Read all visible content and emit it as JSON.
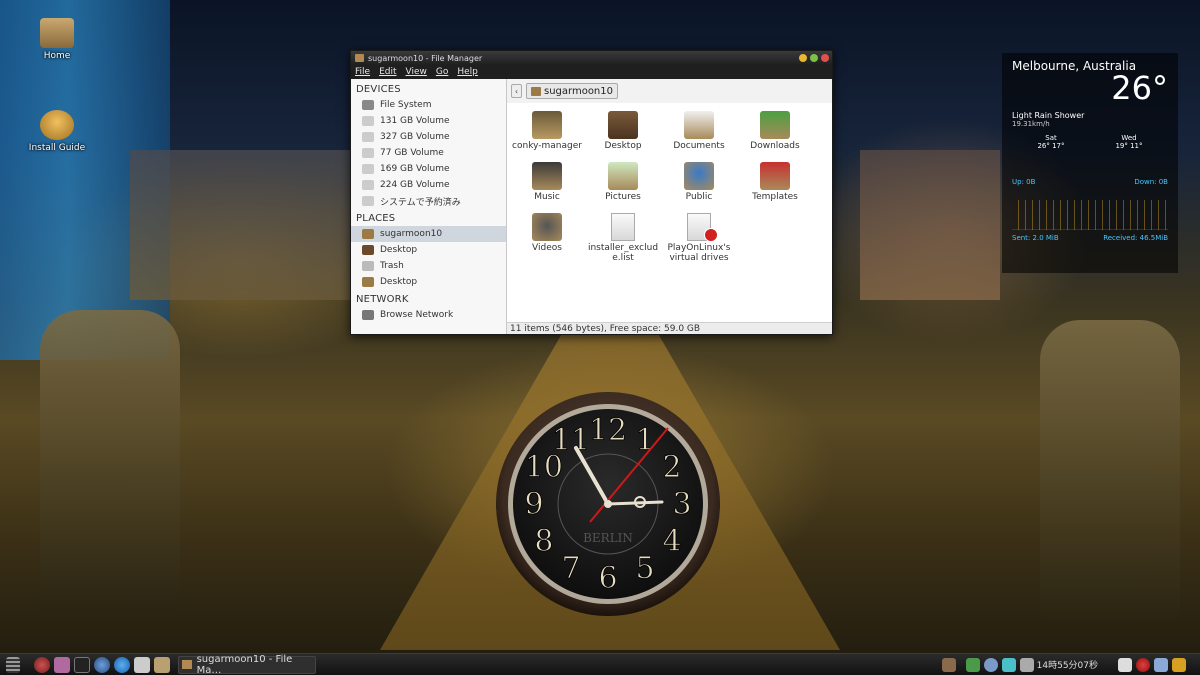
{
  "desktop": {
    "icons": [
      {
        "label": "Home"
      },
      {
        "label": "Install Guide"
      }
    ]
  },
  "window": {
    "title": "sugarmoon10 - File Manager",
    "menu": [
      "File",
      "Edit",
      "View",
      "Go",
      "Help"
    ],
    "sidebar": {
      "devices_heading": "DEVICES",
      "devices": [
        "File System",
        "131 GB Volume",
        "327 GB Volume",
        "77 GB Volume",
        "169 GB Volume",
        "224 GB Volume",
        "システムで予約済み"
      ],
      "places_heading": "PLACES",
      "places": [
        "sugarmoon10",
        "Desktop",
        "Trash",
        "Desktop"
      ],
      "network_heading": "NETWORK",
      "network": [
        "Browse Network"
      ]
    },
    "pathbar": {
      "back": "‹",
      "crumb": "sugarmoon10"
    },
    "files": [
      {
        "label": "conky-manager"
      },
      {
        "label": "Desktop"
      },
      {
        "label": "Documents"
      },
      {
        "label": "Downloads"
      },
      {
        "label": "Music"
      },
      {
        "label": "Pictures"
      },
      {
        "label": "Public"
      },
      {
        "label": "Templates"
      },
      {
        "label": "Videos"
      },
      {
        "label": "installer_exclude.list"
      },
      {
        "label": "PlayOnLinux's virtual drives"
      }
    ],
    "status": "11 items (546 bytes), Free space: 59.0 GB"
  },
  "weather": {
    "city": "Melbourne, Australia",
    "temp": "26°",
    "condition": "Light Rain Shower",
    "wind": "19.31km/h",
    "days": [
      {
        "day": "Sat",
        "range": "26° 17°"
      },
      {
        "day": "Wed",
        "range": "19° 11°"
      }
    ],
    "up": "Up: 0B",
    "down": "Down: 0B",
    "sent": "Sent: 2.0 MiB",
    "received": "Received: 46.5MiB"
  },
  "clock": {
    "brand": "BERLIN",
    "numerals": [
      "12",
      "1",
      "2",
      "3",
      "4",
      "5",
      "6",
      "7",
      "8",
      "9",
      "10",
      "11"
    ]
  },
  "taskbar": {
    "task_label": "sugarmoon10 - File Ma…",
    "time": "14時55分07秒"
  },
  "colors": {
    "selection": "#cfd6de",
    "accent_blue": "#49c6ff",
    "close_red": "#e05050",
    "min_yellow": "#e8b830",
    "max_green": "#7cc04a"
  }
}
